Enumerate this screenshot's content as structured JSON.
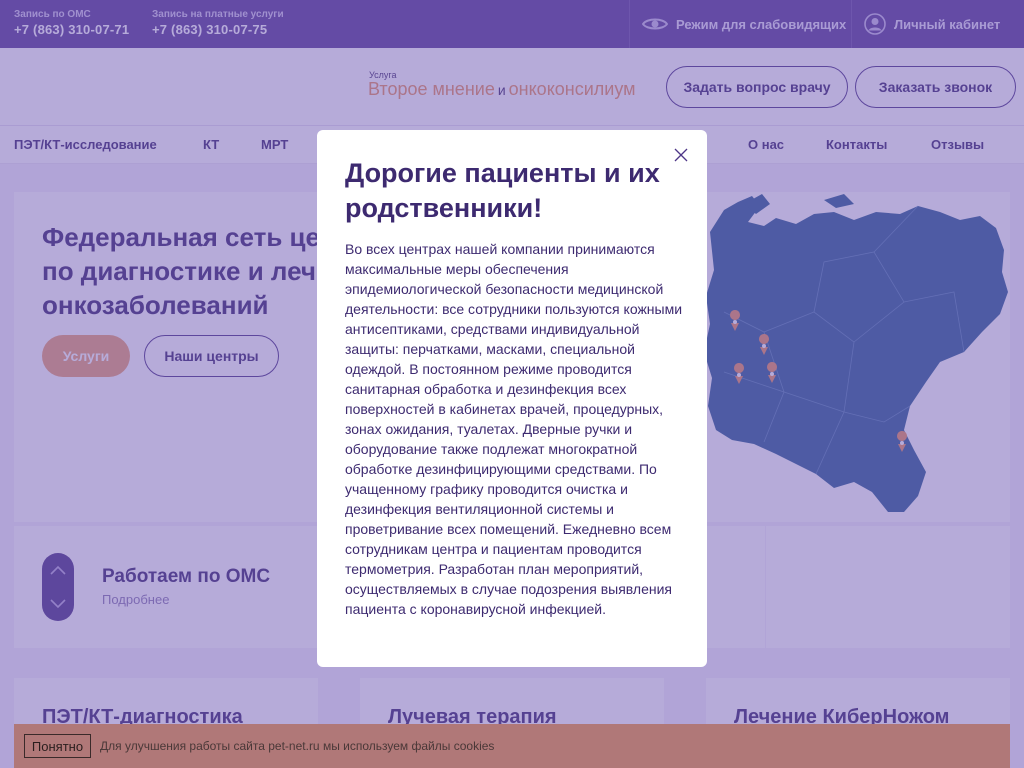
{
  "topbar": {
    "oms_label": "Запись по ОМС",
    "oms_phone": "+7 (863) 310-07-71",
    "paid_label": "Запись на платные услуги",
    "paid_phone": "+7 (863) 310-07-75",
    "accessibility": "Режим для слабовидящих",
    "cabinet": "Личный кабинет"
  },
  "header": {
    "service_tag": "Услуга",
    "service_part1": "Второе мнение",
    "service_and": "и",
    "service_part2": "онкоконсилиум",
    "ask_doctor": "Задать вопрос врачу",
    "order_call": "Заказать звонок"
  },
  "nav": {
    "items": [
      "ПЭТ/КТ-исследование",
      "КТ",
      "МРТ",
      "О нас",
      "Контакты",
      "Отзывы"
    ]
  },
  "hero": {
    "line1": "Федеральная сеть центров",
    "line2": "по диагностике и лечению",
    "line3": "онкозаболеваний",
    "btn_services": "Услуги",
    "btn_centers": "Наши центры"
  },
  "slider": {
    "title": "Работаем по ОМС",
    "link": "Подробнее"
  },
  "cards": [
    "ПЭТ/КТ-диагностика",
    "Лучевая терапия",
    "Лечение КиберНожом"
  ],
  "modal": {
    "title": "Дорогие пациенты и их родственники!",
    "body": "Во всех центрах нашей компании принимаются максимальные меры обеспечения эпидемиологической безопасности медицинской деятельности: все сотрудники пользуются кожными антисептиками, средствами индивидуальной защиты: перчатками, масками, специальной одеждой. В постоянном режиме проводится санитарная обработка и дезинфекция всех поверхностей в кабинетах врачей, процедурных, зонах ожидания, туалетах. Дверные ручки и оборудование также подлежат многократной обработке дезинфицирующими средствами. По учащенному графику проводится очистка и дезинфекция вентиляционной системы и проветривание всех помещений. Ежедневно всем сотрудникам центра и пациентам проводится термометрия. Разработан план мероприятий, осуществляемых в случае подозрения выявления пациента с коронавирусной инфекцией."
  },
  "cookie": {
    "button": "Понятно",
    "text": "Для улучшения работы сайта pet-net.ru мы используем файлы cookies"
  },
  "colors": {
    "brand_purple": "#5a3f96",
    "text_dark": "#3d2a70",
    "accent_orange": "#eba173",
    "map_blue": "#2e5f94",
    "cookie_bg": "#b07878"
  }
}
